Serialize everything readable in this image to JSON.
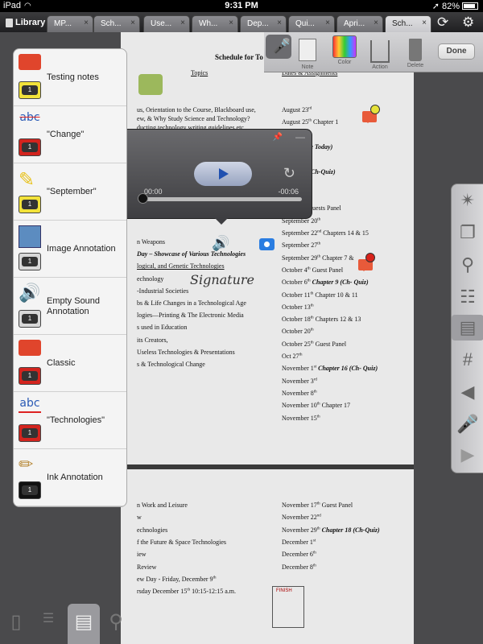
{
  "status_bar": {
    "device": "iPad",
    "time": "9:31 PM",
    "battery": "82%"
  },
  "tab_bar": {
    "library_label": "Library",
    "tabs": [
      {
        "label": "MP..."
      },
      {
        "label": "Sch..."
      },
      {
        "label": "Use..."
      },
      {
        "label": "Wh..."
      },
      {
        "label": "Dep..."
      },
      {
        "label": "Qui..."
      },
      {
        "label": "Apri..."
      },
      {
        "label": "Sch...",
        "active": true
      }
    ],
    "close_glyph": "×"
  },
  "annotation_toolbar": {
    "items": [
      {
        "label": "Note"
      },
      {
        "label": "Color"
      },
      {
        "label": "Action"
      },
      {
        "label": "Delete"
      }
    ],
    "done_label": "Done"
  },
  "annotation_list": {
    "items": [
      {
        "label": "Testing notes",
        "icon": "note-icon",
        "count": "1",
        "badge_color": "#f2e23a"
      },
      {
        "label": "\"Change\"",
        "icon": "strikethrough-icon",
        "glyph": "abc",
        "count": "1",
        "badge_color": "#d2241e"
      },
      {
        "label": "\"September\"",
        "icon": "highlighter-icon",
        "glyph": "✎",
        "count": "1",
        "badge_color": "#f2e23a"
      },
      {
        "label": "Image Annotation",
        "icon": "image-icon",
        "count": "1",
        "badge_color": "#d8d8d8"
      },
      {
        "label": "Empty Sound Annotation",
        "icon": "speaker-icon",
        "glyph": "🔊",
        "count": "1",
        "badge_color": "#d8d8d8"
      },
      {
        "label": "Classic",
        "icon": "note-icon",
        "count": "1",
        "badge_color": "#d2241e"
      },
      {
        "label": "\"Technologies\"",
        "icon": "underline-icon",
        "glyph": "abc",
        "count": "1",
        "badge_color": "#d2241e"
      },
      {
        "label": "Ink Annotation",
        "icon": "pencil-icon",
        "glyph": "✏",
        "count": "1",
        "badge_color": "#111111"
      }
    ]
  },
  "audio_player": {
    "elapsed": "00:00",
    "remaining": "-00:06",
    "progress": 0
  },
  "document": {
    "title": "Schedule for To",
    "col_topics": "Topics",
    "col_dates": "Dates & Assignments",
    "signature": "Signature",
    "finish_label": "FINISH",
    "page1_left": [
      {
        "t": "us, Orientation to the Course, Blackboard use,"
      },
      {
        "t": "ew, & Why Study Science and Technology?"
      },
      {
        "t": "ducting technology writing guidelines etc"
      },
      {
        "t": "n Weapons"
      },
      {
        "t": "Day – Showcase of Various Technologies",
        "cls": "bi"
      },
      {
        "t": "logical, and Genetic Technologies",
        "cls": "ul"
      },
      {
        "t": "echnology"
      },
      {
        "t": "-Industrial Societies"
      },
      {
        "t": "bs & Life Changes in a Technological Age"
      },
      {
        "t": "logies—Printing & The Electronic Media"
      },
      {
        "t": "s used in Education"
      },
      {
        "t": "its Creators,"
      },
      {
        "t": "Useless Technologies & Presentations"
      },
      {
        "t": "s & Technological Change"
      }
    ],
    "page1_right": [
      {
        "a": "August 23",
        "s": "rd"
      },
      {
        "a": "August 25",
        "s": "th",
        "b": " Chapter 1"
      },
      {
        "a": "Chapters 2"
      },
      {
        "a": "gnment due Today)",
        "cls": "bi"
      },
      {
        "a": "Chapter 3"
      },
      {
        "a": "Chapter 4 ",
        "b": "(Ch-Quiz)"
      },
      {
        "a": "pter 5"
      },
      {
        "a": "3",
        "s": "th",
        "b": " Videos"
      },
      {
        "a": "apter 6 & Guests Panel"
      },
      {
        "a": "September 20",
        "s": "th"
      },
      {
        "a": "September 22",
        "s": "nd",
        "b": " Chapters 14 & 15"
      },
      {
        "a": "September 27",
        "s": "th"
      },
      {
        "a": "September 29",
        "s": "th",
        "b": " Chapter 7 &"
      },
      {
        "a": "October 4",
        "s": "th",
        "b": " Guest Panel"
      },
      {
        "a": "October 6",
        "s": "th",
        "b": " Chapter 9 (Ch- Quiz)"
      },
      {
        "a": "October 11",
        "s": "th",
        "b": " Chapter 10 & 11"
      },
      {
        "a": "October 13",
        "s": "th"
      },
      {
        "a": "October 18",
        "s": "th",
        "b": " Chapters 12 & 13"
      },
      {
        "a": "October 20",
        "s": "th"
      },
      {
        "a": "October 25",
        "s": "th",
        "b": " Guest Panel"
      },
      {
        "a": "Oct 27",
        "s": "th"
      },
      {
        "a": "November 1",
        "s": "st",
        "b": " Chapter 16 (Ch- Quiz)"
      },
      {
        "a": "November 3",
        "s": "rd"
      },
      {
        "a": "November 8",
        "s": "th"
      },
      {
        "a": "November 10",
        "s": "th",
        "b": " Chapter 17"
      },
      {
        "a": "November 15",
        "s": "th"
      }
    ],
    "page2_left": [
      {
        "t": "n Work and Leisure"
      },
      {
        "t": "w"
      },
      {
        "t": "echnologies"
      },
      {
        "t": "f the Future & Space Technologies"
      },
      {
        "t": "iew"
      },
      {
        "t": "Review"
      },
      {
        "t": "ew Day - Friday, December 9",
        "s": "th",
        "cls": "b"
      },
      {
        "t": "rsday December 15",
        "s": "th",
        "b": " 10:15-12:15 a.m."
      }
    ],
    "page2_right": [
      {
        "a": "November 17",
        "s": "th",
        "b": " Guest Panel"
      },
      {
        "a": "November 22",
        "s": "nd"
      },
      {
        "a": "November 29",
        "s": "th",
        "b": " Chapter 18 (Ch-Quiz)"
      },
      {
        "a": "December 1",
        "s": "st"
      },
      {
        "a": "December 6",
        "s": "th"
      },
      {
        "a": "December 8",
        "s": "th"
      }
    ]
  },
  "colors": {
    "note_red": "#e0452c",
    "accent_blue": "#2a7de1",
    "highlight_yellow": "#f2e23a"
  }
}
